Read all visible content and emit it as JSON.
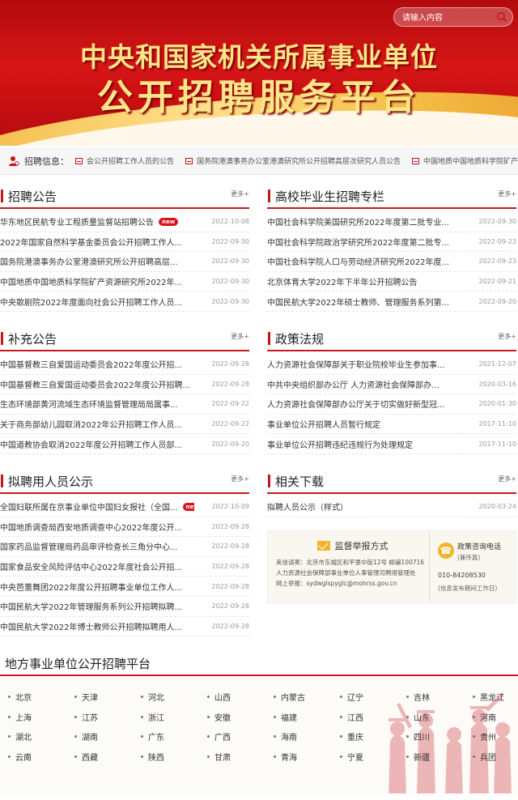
{
  "header": {
    "title_line1": "中央和国家机关所属事业单位",
    "title_line2": "公开招聘服务平台",
    "search_placeholder": "请输入内容"
  },
  "ticker": {
    "label": "招聘信息：",
    "items": [
      "会公开招聘工作人员的公告",
      "国务院港澳事务办公室港澳研究所公开招聘高层次研究人员公告",
      "中国地质中国地质科学院矿产"
    ]
  },
  "recruit": {
    "title": "招聘公告",
    "more": "更多+",
    "rows": [
      {
        "text": "华东地区民航专业工程质量监督站招聘公告",
        "date": "2022-10-08",
        "new": "new"
      },
      {
        "text": "2022年国家自然科学基金委员会公开招聘工作人...",
        "date": "2022-09-30",
        "new": ""
      },
      {
        "text": "国务院港澳事务办公室港澳研究所公开招聘高层...",
        "date": "2022-09-30",
        "new": ""
      },
      {
        "text": "中国地质中国地质科学院矿产资源研究所2022年...",
        "date": "2022-09-30",
        "new": ""
      },
      {
        "text": "中央歌剧院2022年度面向社会公开招聘工作人员...",
        "date": "2022-09-30",
        "new": ""
      }
    ]
  },
  "graduates": {
    "title": "高校毕业生招聘专栏",
    "more": "更多+",
    "rows": [
      {
        "text": "中国社会科学院美国研究所2022年度第二批专业...",
        "date": "2022-09-30"
      },
      {
        "text": "中国社会科学院政治学研究所2022年度第二批专...",
        "date": "2022-09-23"
      },
      {
        "text": "中国社会科学院人口与劳动经济研究所2022年度...",
        "date": "2022-09-23"
      },
      {
        "text": "北京体育大学2022年下半年公开招聘公告",
        "date": "2022-09-21"
      },
      {
        "text": "中国民航大学2022年硕士教师、管理服务系列第...",
        "date": "2022-09-20"
      }
    ]
  },
  "supplement": {
    "title": "补充公告",
    "more": "更多+",
    "rows": [
      {
        "text": "中国基督教三自爱国运动委员会2022年度公开招...",
        "date": "2022-09-28"
      },
      {
        "text": "中国基督教三自爱国运动委员会2022年度公开招聘...",
        "date": "2022-09-28"
      },
      {
        "text": "生态环境部黄河流域生态环境监督管理局局属事...",
        "date": "2022-09-22"
      },
      {
        "text": "关于商务部幼儿园取消2022年公开招聘工作人员...",
        "date": "2022-09-22"
      },
      {
        "text": "中国道教协会取消2022年度公开招聘工作人员部...",
        "date": "2022-09-20"
      }
    ]
  },
  "policy": {
    "title": "政策法规",
    "more": "更多+",
    "rows": [
      {
        "text": "人力资源社会保障部关于职业院校毕业生参加事...",
        "date": "2021-12-07"
      },
      {
        "text": "中共中央组织部办公厅 人力资源社会保障部办...",
        "date": "2020-03-16"
      },
      {
        "text": "人力资源社会保障部办公厅关于切实做好新型冠...",
        "date": "2020-01-30"
      },
      {
        "text": "事业单位公开招聘人员暂行规定",
        "date": "2017-11-10"
      },
      {
        "text": "事业单位公开招聘违纪违规行为处理规定",
        "date": "2017-11-10"
      }
    ]
  },
  "hiring": {
    "title": "拟聘用人员公示",
    "more": "更多+",
    "rows": [
      {
        "text": "全国妇联所属在京事业单位中国妇女报社（全国...",
        "date": "2022-10-09",
        "new": "new"
      },
      {
        "text": "中国地质调查局西安地质调查中心2022年度公开...",
        "date": "2022-09-28",
        "new": ""
      },
      {
        "text": "国家药品监督管理局药品审评检查长三角分中心...",
        "date": "2022-09-28",
        "new": ""
      },
      {
        "text": "国家食品安全风险评估中心2022年度社会公开招...",
        "date": "2022-09-28",
        "new": ""
      },
      {
        "text": "中央芭蕾舞团2022年度公开招聘事业单位工作人...",
        "date": "2022-09-28",
        "new": ""
      },
      {
        "text": "中国民航大学2022年管理服务系列公开招聘拟聘...",
        "date": "2022-09-28",
        "new": ""
      },
      {
        "text": "中国民航大学2022年博士教师公开招聘拟聘用人...",
        "date": "2022-09-28",
        "new": ""
      }
    ]
  },
  "downloads": {
    "title": "相关下载",
    "more": "更多+",
    "rows": [
      {
        "text": "拟聘人员公示（样式）",
        "date": "2020-03-24"
      }
    ]
  },
  "report": {
    "title": "监督举报方式",
    "line1": "来信请寄：北京市东城区和平里中街12号 邮编100716",
    "line2": "人力资源社会保障部事业单位人事管理司聘用管理处",
    "line3": "网上举报：sydwglspyglc@mohrss.gov.cn",
    "phone_title": "政策咨询电话",
    "phone_sub": "(兼传真)",
    "phone_number": "010-84208530",
    "phone_note": "(信息发布期间工作日)"
  },
  "local": {
    "title": "地方事业单位公开招聘平台",
    "provinces": [
      "北京",
      "天津",
      "河北",
      "山西",
      "内蒙古",
      "辽宁",
      "吉林",
      "黑龙江",
      "上海",
      "江苏",
      "浙江",
      "安徽",
      "福建",
      "江西",
      "山东",
      "河南",
      "湖北",
      "湖南",
      "广东",
      "广西",
      "海南",
      "重庆",
      "四川",
      "贵州",
      "云南",
      "西藏",
      "陕西",
      "甘肃",
      "青海",
      "宁夏",
      "新疆",
      "兵团"
    ]
  },
  "colors": {
    "brand_red": "#c5181d",
    "gold": "#ffe58a"
  }
}
